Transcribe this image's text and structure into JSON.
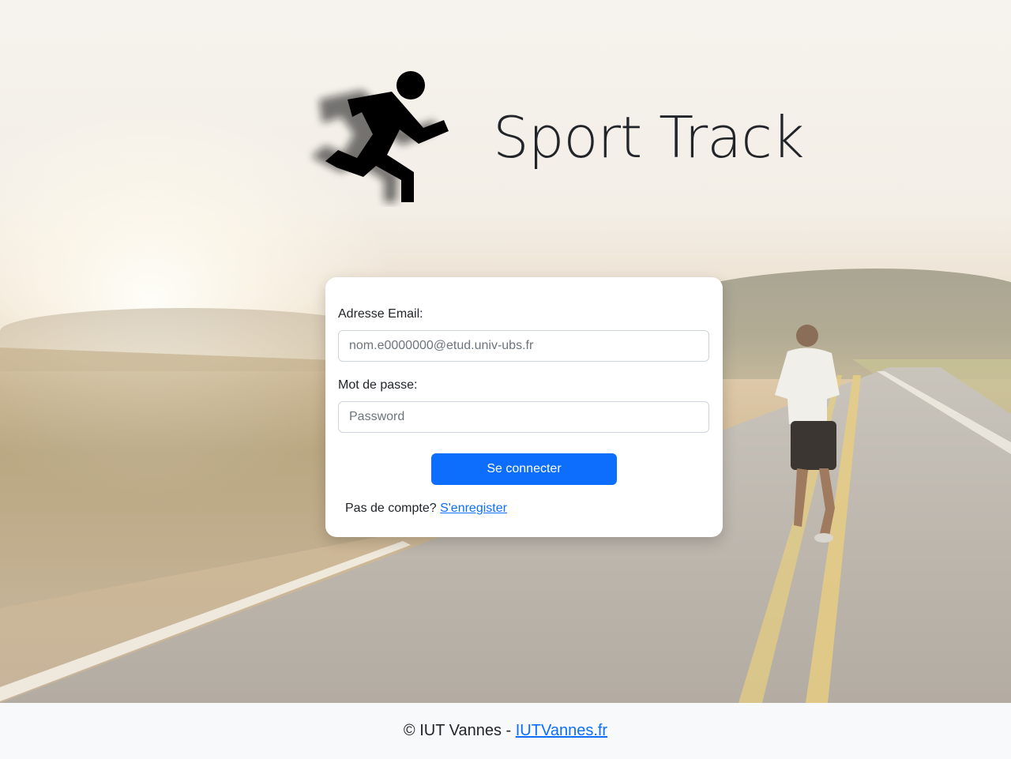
{
  "brand": {
    "title": "Sport Track",
    "logo_icon": "running-man-icon"
  },
  "login_form": {
    "email_label": "Adresse Email:",
    "email_placeholder": "nom.e0000000@etud.univ-ubs.fr",
    "email_value": "",
    "password_label": "Mot de passe:",
    "password_placeholder": "Password",
    "password_value": "",
    "submit_label": "Se connecter",
    "signup_prompt": "Pas de compte?",
    "signup_link": "S'enregister"
  },
  "footer": {
    "copyright": "© IUT Vannes -",
    "link": "IUTVannes.fr"
  },
  "colors": {
    "primary": "#0d6efd",
    "footer_bg": "#f8f9fa",
    "text": "#212529"
  }
}
